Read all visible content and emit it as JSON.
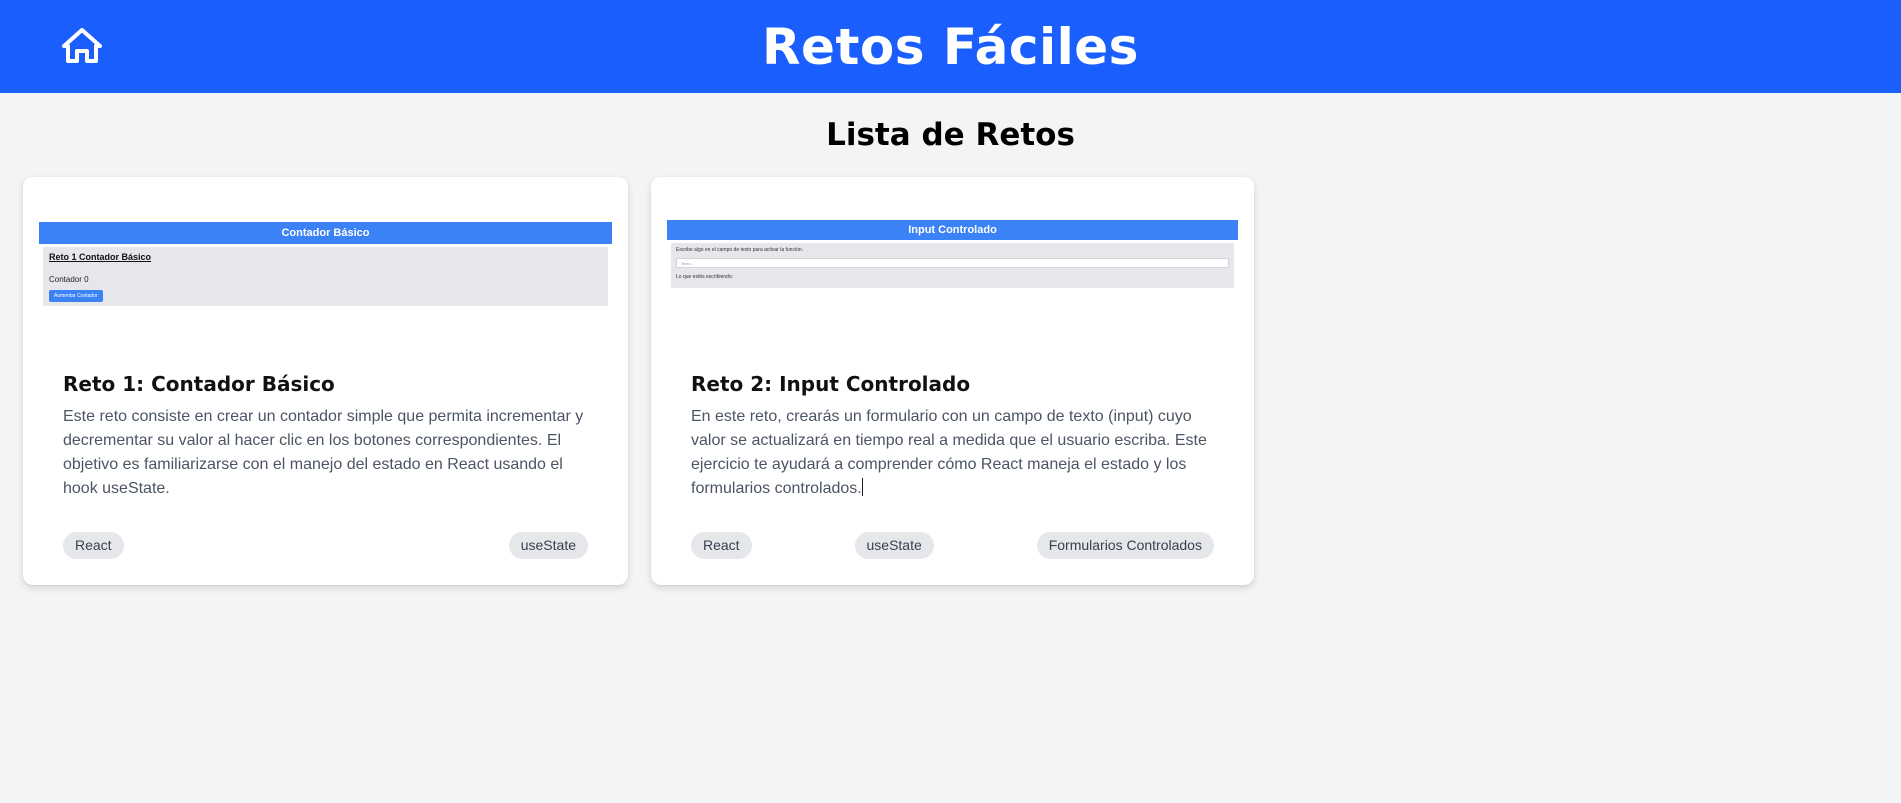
{
  "header": {
    "title": "Retos Fáciles",
    "home_icon": "home-icon",
    "color": "#1a5ffe"
  },
  "main": {
    "heading": "Lista de Retos"
  },
  "cards": [
    {
      "preview": {
        "bar_title": "Contador Básico",
        "heading": "Reto 1 Contador Básico",
        "counter_text": "Contador 0",
        "button_label": "Aumentar Contador"
      },
      "title": "Reto 1: Contador Básico",
      "description": "Este reto consiste en crear un contador simple que permita incrementar y decrementar su valor al hacer clic en los botones correspondientes. El objetivo es familiarizarse con el manejo del estado en React usando el hook useState.",
      "tags": [
        "React",
        "useState"
      ]
    },
    {
      "preview": {
        "bar_title": "Input Controlado",
        "instruction": "Escribe algo en el campo de texto para activar la función.",
        "input_placeholder": "Texto...",
        "output_text": "Lo que estés escribiendo:"
      },
      "title": "Reto 2: Input Controlado",
      "description": "En este reto, crearás un formulario con un campo de texto (input) cuyo valor se actualizará en tiempo real a medida que el usuario escriba. Este ejercicio te ayudará a comprender cómo React maneja el estado y los formularios controlados.",
      "tags": [
        "React",
        "useState",
        "Formularios Controlados"
      ]
    }
  ],
  "colors": {
    "preview_bar": "#3b82f6",
    "page_bg": "#f3f4f6",
    "tag_bg": "#e5e7eb"
  }
}
